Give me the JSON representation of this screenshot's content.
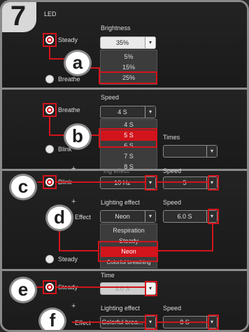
{
  "step": "7",
  "led_label": "LED",
  "panel1": {
    "steady_label": "Steady",
    "breathe_label": "Breathe",
    "brightness_label": "Brightness",
    "brightness_value": "35%",
    "options": [
      "5%",
      "15%",
      "25%"
    ],
    "callout": "a"
  },
  "panel2": {
    "breathe_label": "Breathe",
    "blink_label": "Blink",
    "speed_label": "Speed",
    "speed_value": "4 S",
    "options": [
      "4 S",
      "5 S",
      "6 S",
      "7 S",
      "8 S"
    ],
    "times_label": "Times",
    "callout": "b"
  },
  "panel3": {
    "blink_label": "Blink",
    "freq_value": "10 Hz",
    "speed_label": "Speed",
    "speed_value": "5",
    "partial_label": "ing effect",
    "callout": "c"
  },
  "panel4": {
    "lighting_effect_label": "Lighting effect",
    "speed_label": "Speed",
    "effect_label": "Effect",
    "effect_value": "Neon",
    "speed_value": "6.0 S",
    "options": [
      "Respiration",
      "Steady",
      "Neon",
      "Colorful breathing"
    ],
    "steady_label": "Steady",
    "callout": "d"
  },
  "panel5": {
    "time_label": "Time",
    "steady_label": "Steady",
    "time_value": "3.0 S",
    "callout": "e"
  },
  "panel6": {
    "lighting_effect_label": "Lighting effect",
    "speed_label": "Speed",
    "effect_label": "Effect",
    "effect_value": "Colorful brea...",
    "speed_value": "8 S",
    "callout": "f"
  },
  "plus": "+",
  "arrow": "▾",
  "colors": {
    "accent": "#d2141c",
    "frame": "#8a8a8a"
  }
}
